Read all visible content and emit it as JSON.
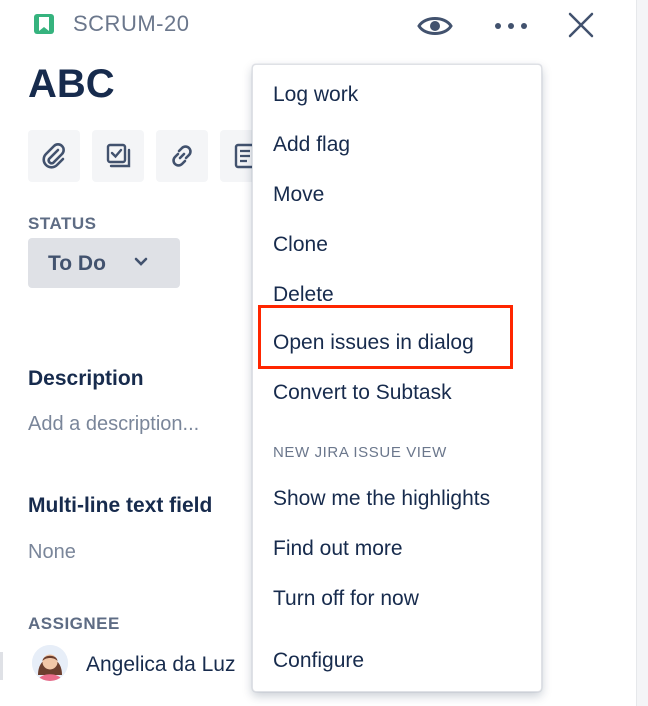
{
  "header": {
    "issue_key": "SCRUM-20",
    "issue_type_icon": "story-bookmark-icon",
    "watch_icon": "eye-icon",
    "more_icon": "more-horizontal-icon",
    "close_icon": "close-icon"
  },
  "issue": {
    "title": "ABC",
    "toolbar_icons": [
      "attachment-icon",
      "subtask-icon",
      "link-icon",
      "page-icon"
    ]
  },
  "status": {
    "label": "STATUS",
    "value": "To Do"
  },
  "description": {
    "heading": "Description",
    "placeholder": "Add a description..."
  },
  "multiline_field": {
    "heading": "Multi-line text field",
    "value": "None"
  },
  "assignee": {
    "label": "ASSIGNEE",
    "name": "Angelica da Luz"
  },
  "menu": {
    "items": [
      "Log work",
      "Add flag",
      "Move",
      "Clone",
      "Delete",
      "Open issues in dialog",
      "Convert to Subtask"
    ],
    "group_label": "NEW JIRA ISSUE VIEW",
    "group_items": [
      "Show me the highlights",
      "Find out more",
      "Turn off for now"
    ],
    "footer_item": "Configure"
  },
  "colors": {
    "issue_type": "#36b37e",
    "highlight": "#ff2600",
    "text_primary": "#172b4d",
    "text_subtle": "#6b778c"
  }
}
